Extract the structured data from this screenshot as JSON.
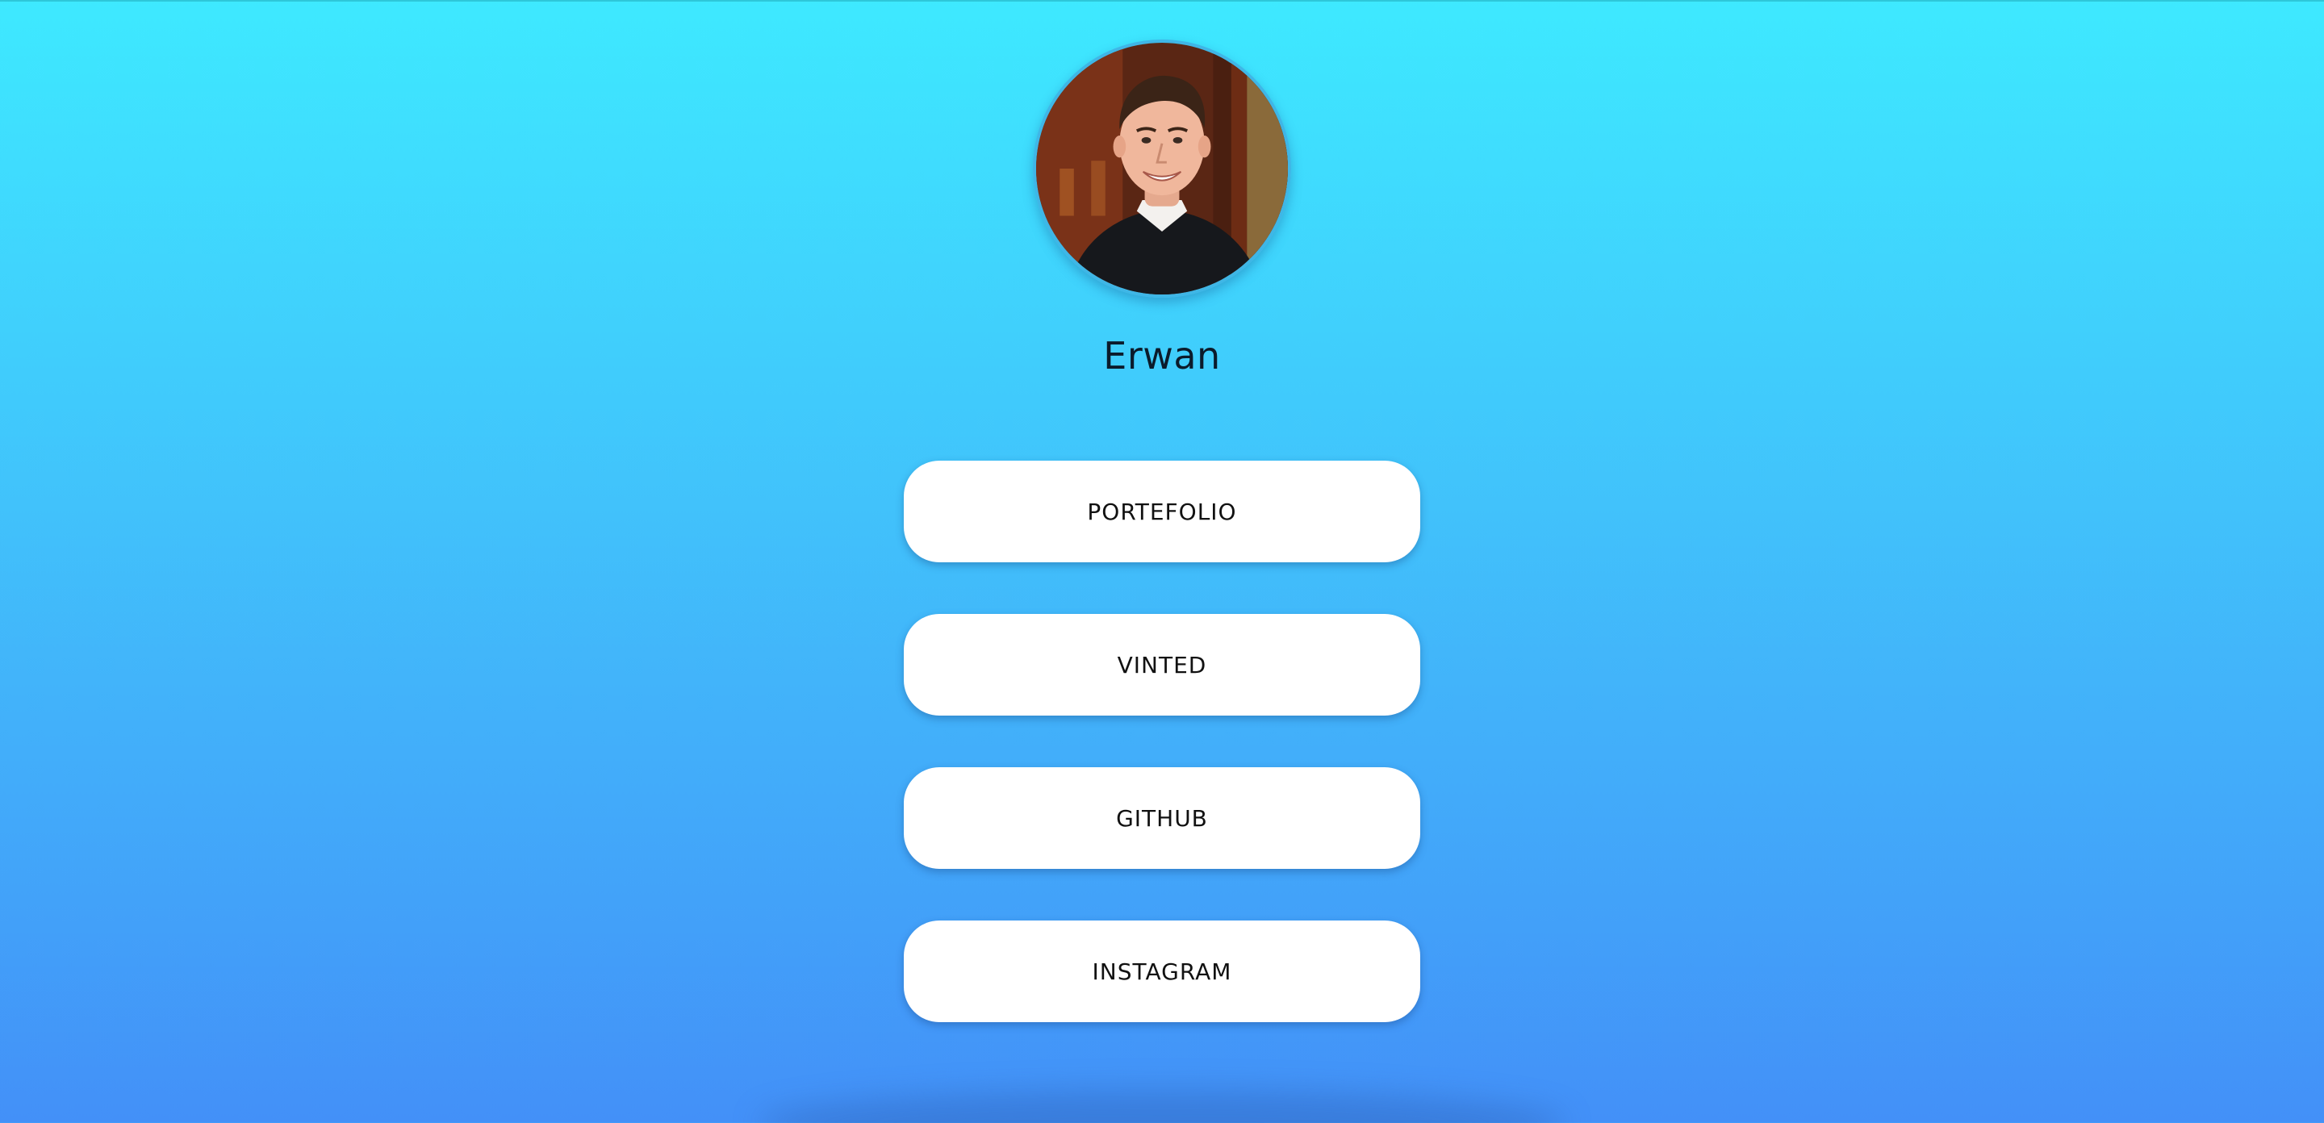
{
  "profile": {
    "name": "Erwan",
    "avatar_icon": "profile-photo"
  },
  "links": [
    {
      "label": "PORTEFOLIO"
    },
    {
      "label": "VINTED"
    },
    {
      "label": "GITHUB"
    },
    {
      "label": "INSTAGRAM"
    }
  ],
  "colors": {
    "background_top": "#3ee9ff",
    "background_bottom": "#4390f8",
    "button_bg": "#ffffff",
    "text": "#111111"
  }
}
